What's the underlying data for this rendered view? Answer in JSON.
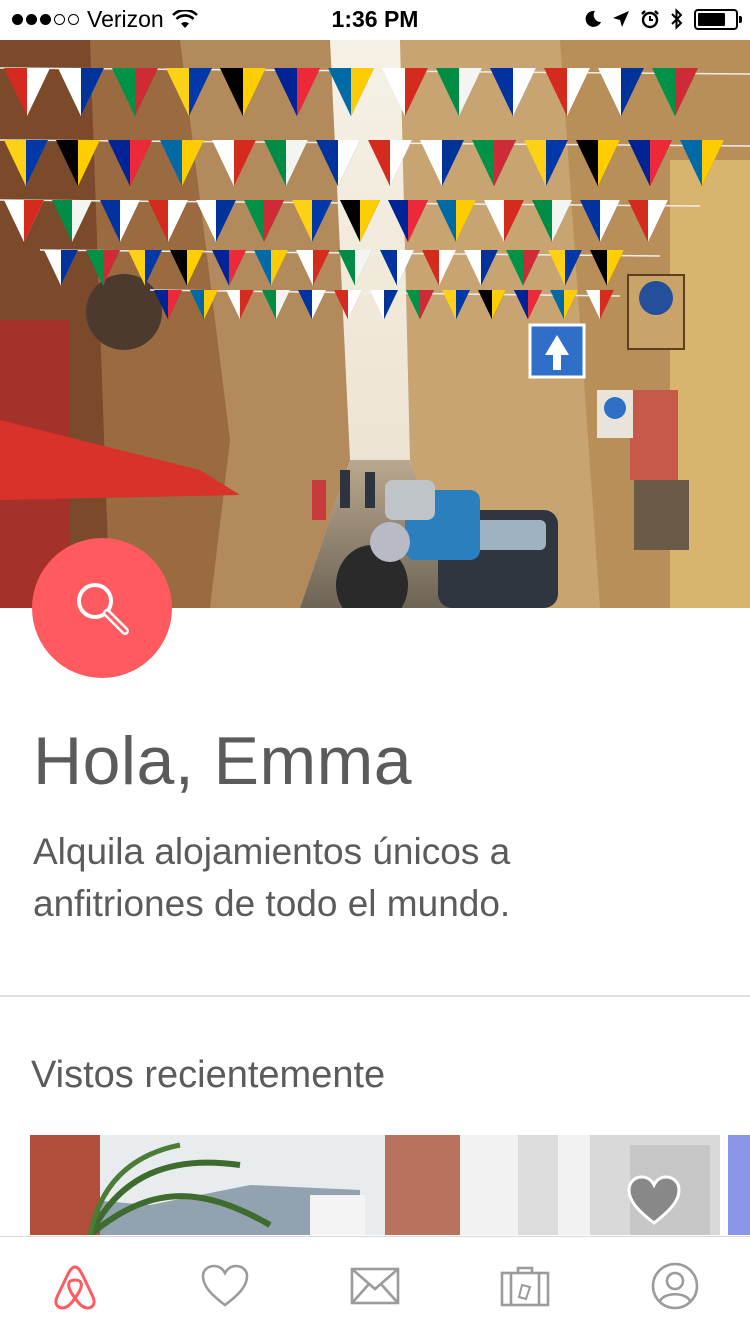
{
  "status_bar": {
    "carrier": "Verizon",
    "time": "1:36 PM",
    "signal_bars_filled": 3,
    "signal_bars_total": 5,
    "battery_level": 0.75
  },
  "hero": {
    "image": "street-with-international-flags",
    "accent_color": "#ff5a5f"
  },
  "search_button": {
    "icon": "search-icon"
  },
  "greeting": "Hola, Emma",
  "subtitle": "Alquila alojamientos únicos a anfitriones de todo el mundo.",
  "recently_viewed": {
    "title": "Vistos recientemente",
    "card_icon": "heart-icon"
  },
  "tab_bar": {
    "active_color": "#ff5a5f",
    "inactive_color": "#9b9b9b",
    "tabs": [
      {
        "icon": "airbnb-logo-icon",
        "active": true
      },
      {
        "icon": "heart-icon",
        "active": false
      },
      {
        "icon": "envelope-icon",
        "active": false
      },
      {
        "icon": "suitcase-icon",
        "active": false
      },
      {
        "icon": "profile-icon",
        "active": false
      }
    ]
  }
}
